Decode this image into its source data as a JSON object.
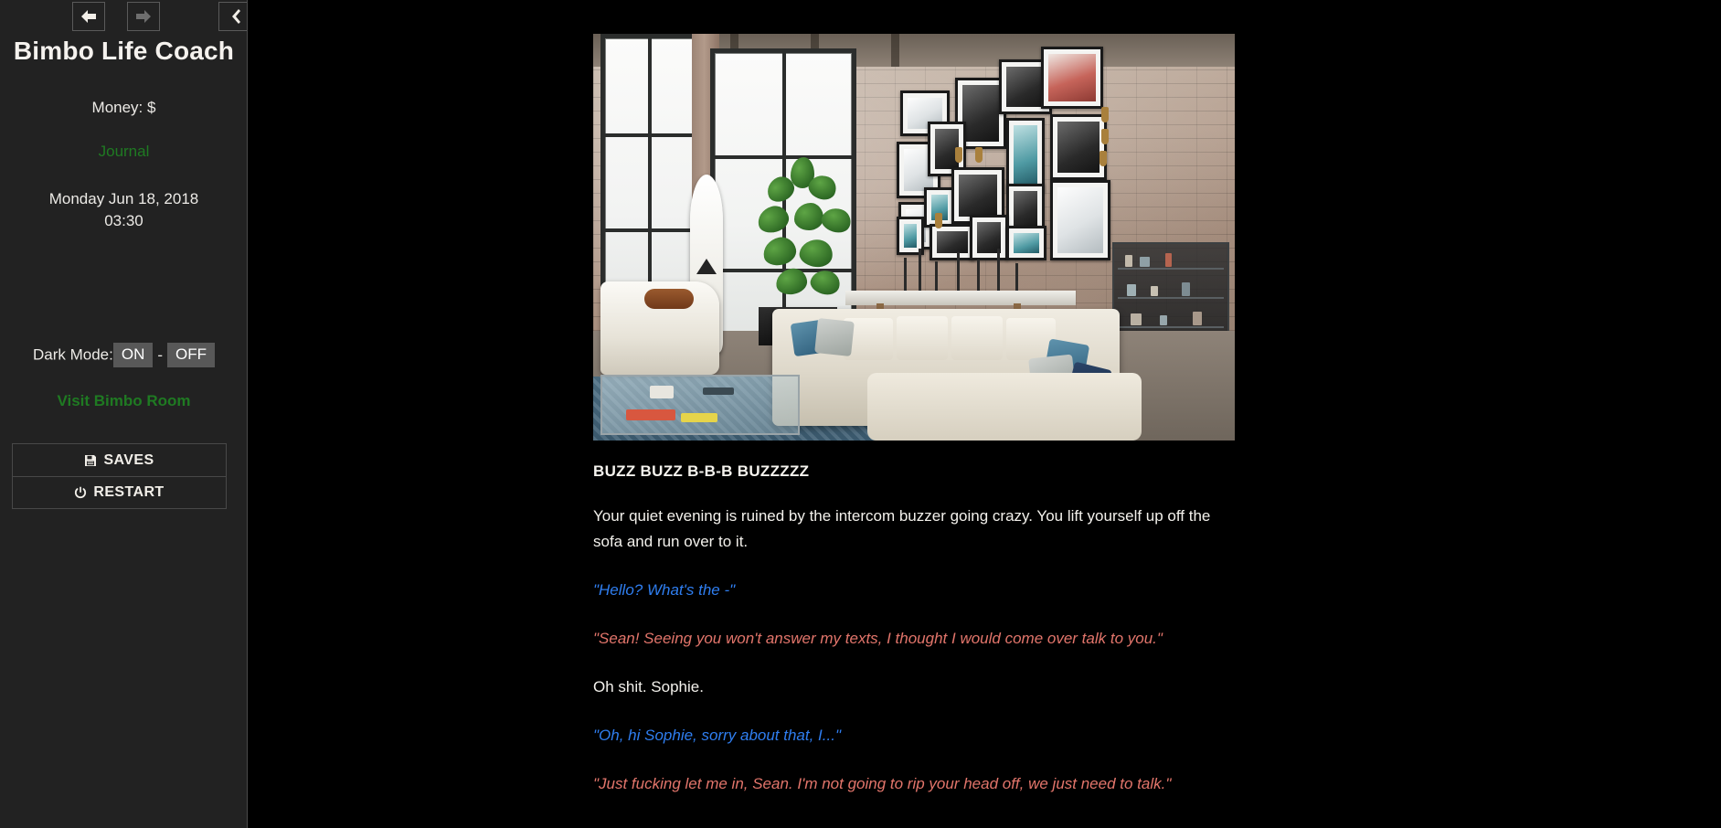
{
  "sidebar": {
    "nav": {
      "back_icon": "arrow-left-icon",
      "forward_icon": "arrow-right-icon",
      "collapse_icon": "chevron-left-icon"
    },
    "title": "Bimbo Life Coach",
    "money_label": "Money: $",
    "journal_link": "Journal",
    "date": "Monday Jun 18, 2018",
    "time": "03:30",
    "dark_mode": {
      "label": "Dark Mode:",
      "on": "ON",
      "separator": "-",
      "off": "OFF"
    },
    "visit_room_link": "Visit Bimbo Room",
    "saves_button": "SAVES",
    "saves_icon": "floppy-disk-icon",
    "restart_button": "RESTART",
    "restart_icon": "power-icon"
  },
  "story": {
    "image_alt": "Industrial loft living room with exposed brick wall, gallery wall of framed black-and-white photographs, tall black-framed windows, fiddle-leaf fig plant, surfboard, white sectional sofa with blue and navy cushions, and a glass coffee table on a blue rug",
    "heading": "BUZZ BUZZ B-B-B BUZZZZZ",
    "paragraph": "Your quiet evening is ruined by the intercom buzzer going crazy. You lift yourself up off the sofa and run over to it.",
    "lines": [
      {
        "text": "\"Hello? What's the -\"",
        "speaker": "player",
        "color": "#2f7ef0"
      },
      {
        "text": "\"Sean! Seeing you won't answer my texts, I thought I would come over talk to you.\"",
        "speaker": "sophie",
        "color": "#e2756b"
      },
      {
        "text": "Oh shit. Sophie.",
        "speaker": "narration",
        "color": "#f3f1ec"
      },
      {
        "text": "\"Oh, hi Sophie, sorry about that, I...\"",
        "speaker": "player",
        "color": "#2f7ef0"
      },
      {
        "text": "\"Just fucking let me in, Sean. I'm not going to rip your head off, we just need to talk.\"",
        "speaker": "sophie",
        "color": "#e2756b"
      }
    ]
  },
  "colors": {
    "sidebar_bg": "#222222",
    "main_bg": "#000000",
    "link_green": "#1f7a22",
    "dialogue_blue": "#2f7ef0",
    "dialogue_red": "#e2756b",
    "text": "#f3f1ec"
  }
}
